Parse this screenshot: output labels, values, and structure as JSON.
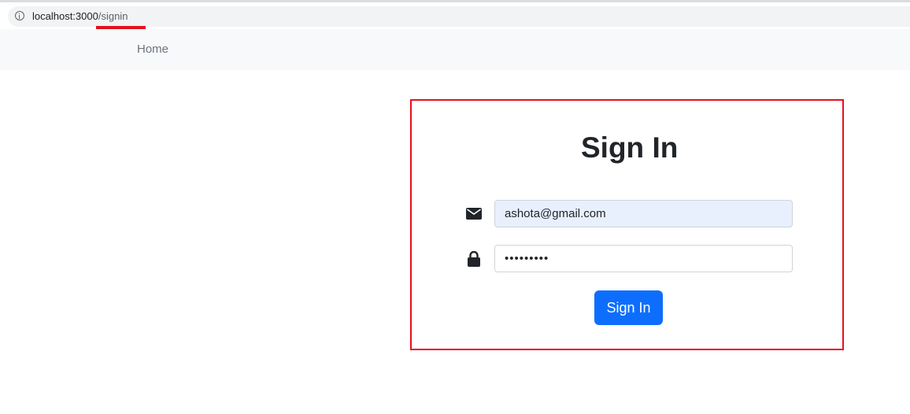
{
  "browser": {
    "url_host": "localhost:3000",
    "url_path": "/signin"
  },
  "navbar": {
    "home_label": "Home"
  },
  "signin": {
    "title": "Sign In",
    "email_value": "ashota@gmail.com",
    "password_value": "•••••••••",
    "submit_label": "Sign In",
    "icons": {
      "email": "envelope-icon",
      "password": "lock-icon"
    }
  },
  "colors": {
    "highlight": "#e3111d",
    "primary": "#0d6efd",
    "autofill_bg": "#e8f0fe",
    "navbar_bg": "#f8f9fa"
  }
}
